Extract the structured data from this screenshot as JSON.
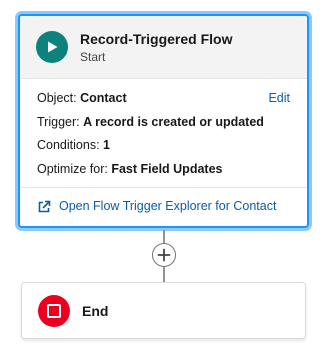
{
  "start_node": {
    "title": "Record-Triggered Flow",
    "subtitle": "Start",
    "icon": "play-icon",
    "icon_color": "#0b827c",
    "selection_color": "#1b96ff",
    "fields": [
      {
        "label": "Object:",
        "value": "Contact"
      },
      {
        "label": "Trigger:",
        "value": "A record is created or updated"
      },
      {
        "label": "Conditions:",
        "value": "1"
      },
      {
        "label": "Optimize for:",
        "value": "Fast Field Updates"
      }
    ],
    "edit_label": "Edit",
    "explorer_link": "Open Flow Trigger Explorer for Contact",
    "explorer_icon": "external-link-icon"
  },
  "connector": {
    "add_icon": "plus-icon"
  },
  "end_node": {
    "label": "End",
    "icon": "stop-icon",
    "icon_color": "#ea001e"
  }
}
